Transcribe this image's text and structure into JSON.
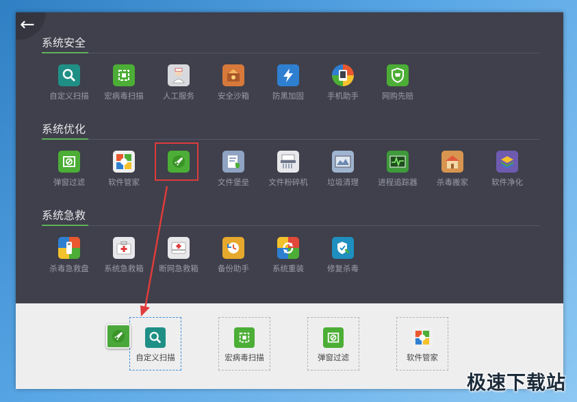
{
  "sections": [
    {
      "title": "系统安全",
      "items": [
        {
          "label": "自定义扫描",
          "icon": "magnifier-icon",
          "color": "#1f8f86"
        },
        {
          "label": "宏病毒扫描",
          "icon": "macro-scan-icon",
          "color": "#4cae36"
        },
        {
          "label": "人工服务",
          "icon": "nurse-icon",
          "color": "#d8d9dd"
        },
        {
          "label": "安全沙箱",
          "icon": "sandbox-icon",
          "color": "#d7793a"
        },
        {
          "label": "防黑加固",
          "icon": "lightning-icon",
          "color": "#2f7fd1"
        },
        {
          "label": "手机助手",
          "icon": "phone-assistant-icon",
          "color": "#e9572f"
        },
        {
          "label": "网购先赔",
          "icon": "shield-cart-icon",
          "color": "#4cae36"
        }
      ]
    },
    {
      "title": "系统优化",
      "items": [
        {
          "label": "弹窗过滤",
          "icon": "popup-block-icon",
          "color": "#4cae36"
        },
        {
          "label": "软件管家",
          "icon": "software-manager-icon",
          "color": "#f1f1f1"
        },
        {
          "label": "",
          "icon": "rocket-icon",
          "color": "#4cae36"
        },
        {
          "label": "文件堡垒",
          "icon": "file-fortress-icon",
          "color": "#8fa3c2"
        },
        {
          "label": "文件粉碎机",
          "icon": "shredder-icon",
          "color": "#e8e8ec"
        },
        {
          "label": "垃圾清理",
          "icon": "cleanup-icon",
          "color": "#9fb4cf"
        },
        {
          "label": "进程追踪器",
          "icon": "process-tracker-icon",
          "color": "#3e9a3a"
        },
        {
          "label": "杀毒搬家",
          "icon": "house-move-icon",
          "color": "#d89550"
        },
        {
          "label": "软件净化",
          "icon": "layers-icon",
          "color": "#6e5bb0"
        }
      ]
    },
    {
      "title": "系统急救",
      "items": [
        {
          "label": "杀毒急救盘",
          "icon": "usb-rescue-icon",
          "color": "#2f7fd1"
        },
        {
          "label": "系统急救箱",
          "icon": "first-aid-kit-icon",
          "color": "#e8e8ec"
        },
        {
          "label": "断网急救箱",
          "icon": "network-aid-icon",
          "color": "#e8e8ec"
        },
        {
          "label": "备份助手",
          "icon": "backup-clock-icon",
          "color": "#e6a92d"
        },
        {
          "label": "系统重装",
          "icon": "reinstall-icon",
          "color": "#e2483a"
        },
        {
          "label": "修复杀毒",
          "icon": "repair-shield-icon",
          "color": "#1f8fbf"
        }
      ]
    }
  ],
  "dock": [
    {
      "label": "自定义扫描",
      "icon": "magnifier-icon",
      "color": "#1f8f86"
    },
    {
      "label": "宏病毒扫描",
      "icon": "macro-scan-icon",
      "color": "#4cae36"
    },
    {
      "label": "弹窗过滤",
      "icon": "popup-block-icon",
      "color": "#4cae36"
    },
    {
      "label": "软件管家",
      "icon": "software-manager-icon",
      "color": "#f1f1f1"
    }
  ],
  "watermark": "极速下载站",
  "accent": "#5fb35a",
  "highlight_color": "#e03b3b"
}
